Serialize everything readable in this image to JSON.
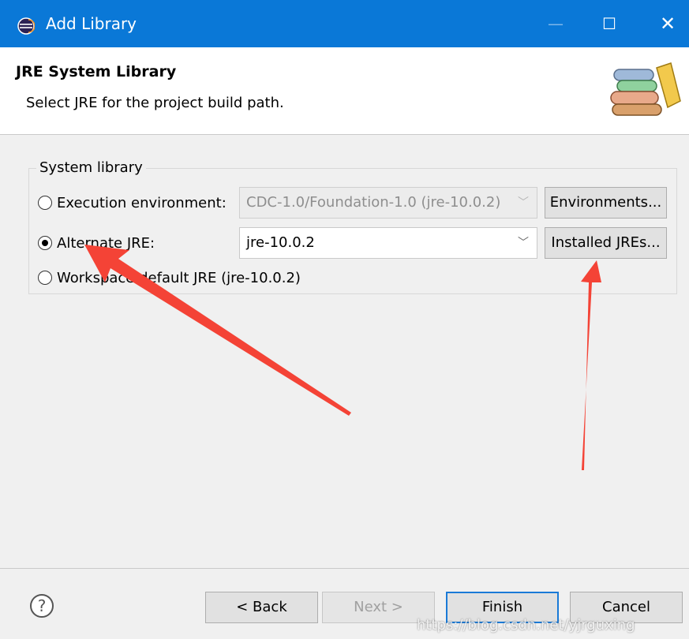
{
  "window": {
    "title": "Add Library",
    "icon": "eclipse-icon",
    "controls": {
      "minimize": "—",
      "maximize": "☐",
      "close": "✕"
    }
  },
  "header": {
    "title": "JRE System Library",
    "description": "Select JRE for the project build path.",
    "icon": "library-books-icon"
  },
  "system_library": {
    "legend": "System library",
    "options": [
      {
        "label": "Execution environment:",
        "checked": false
      },
      {
        "label": "Alternate JRE:",
        "checked": true
      },
      {
        "label": "Workspace default JRE (jre-10.0.2)",
        "checked": false
      }
    ],
    "execution_env_value": "CDC-1.0/Foundation-1.0 (jre-10.0.2)",
    "alternate_jre_value": "jre-10.0.2",
    "environments_button": "Environments...",
    "installed_jres_button": "Installed JREs..."
  },
  "footer": {
    "help_icon": "help-icon",
    "back_button": "< Back",
    "next_button": "Next >",
    "finish_button": "Finish",
    "cancel_button": "Cancel"
  },
  "watermark": "https://blog.csdn.net/yjrguxing",
  "colors": {
    "titlebar": "#0a78d7",
    "annotation_arrow": "#f44336"
  }
}
